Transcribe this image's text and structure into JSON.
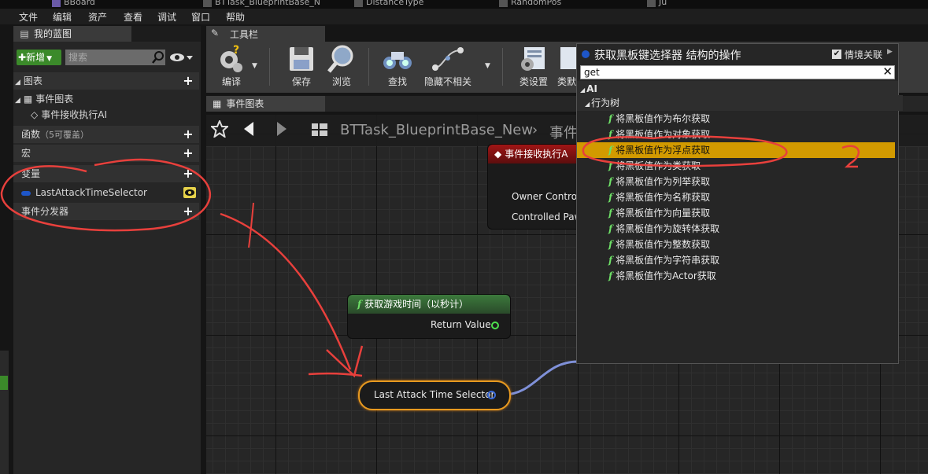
{
  "top_tabs": [
    {
      "label": "BBoard",
      "color": "#5a3c8c"
    },
    {
      "label": "BTTask_BlueprintBase_N",
      "color": "#444"
    },
    {
      "label": "DistanceType",
      "color": "#444"
    },
    {
      "label": "RandomPos",
      "color": "#444"
    },
    {
      "label": "Ju",
      "color": "#444"
    }
  ],
  "menu": [
    "文件",
    "编辑",
    "资产",
    "查看",
    "调试",
    "窗口",
    "帮助"
  ],
  "my_blueprint": {
    "tab_label": "我的蓝图",
    "new_label": "新增",
    "search_placeholder": "搜索",
    "sections": {
      "graphs": "图表",
      "event_graph": "事件图表",
      "event_receive": "事件接收执行AI",
      "functions": "函数",
      "functions_hint": "（5可覆盖）",
      "macros": "宏",
      "variables": "变量",
      "variable_item": "LastAttackTimeSelector",
      "dispatchers": "事件分发器"
    }
  },
  "toolbar": {
    "tab_label": "工具栏",
    "buttons": {
      "compile": "编译",
      "save": "保存",
      "browse": "浏览",
      "find": "查找",
      "hide": "隐藏不相关",
      "class_settings": "类设置",
      "class_defaults": "类默"
    }
  },
  "graph": {
    "tab_label": "事件图表",
    "breadcrumb_asset": "BTTask_BlueprintBase_New",
    "breadcrumb_graph": "事件",
    "event_node": {
      "title": "事件接收执行A",
      "pin1": "Owner Controlle",
      "pin2": "Controlled Paw"
    },
    "time_node": {
      "title": "获取游戏时间（以秒计）",
      "pin": "Return Value"
    },
    "var_node": {
      "label": "Last Attack Time Selector"
    }
  },
  "popup": {
    "title": "获取黑板键选择器 结构的操作",
    "context_label": "情境关联",
    "search_value": "get",
    "category_ai": "AI",
    "category_bt": "行为树",
    "items": [
      "将黑板值作为布尔获取",
      "将黑板值作为对象获取",
      "将黑板值作为浮点获取",
      "将黑板值作为类获取",
      "将黑板值作为列举获取",
      "将黑板值作为名称获取",
      "将黑板值作为向量获取",
      "将黑板值作为旋转体获取",
      "将黑板值作为整数获取",
      "将黑板值作为字符串获取",
      "将黑板值作为Actor获取"
    ],
    "selected_index": 2,
    "annotation": "2"
  },
  "colors": {
    "accent_green": "#3b8a2a",
    "selected_row": "#d29a00",
    "annotation_red": "#e8403c",
    "wire_blue": "#7f90d8"
  }
}
